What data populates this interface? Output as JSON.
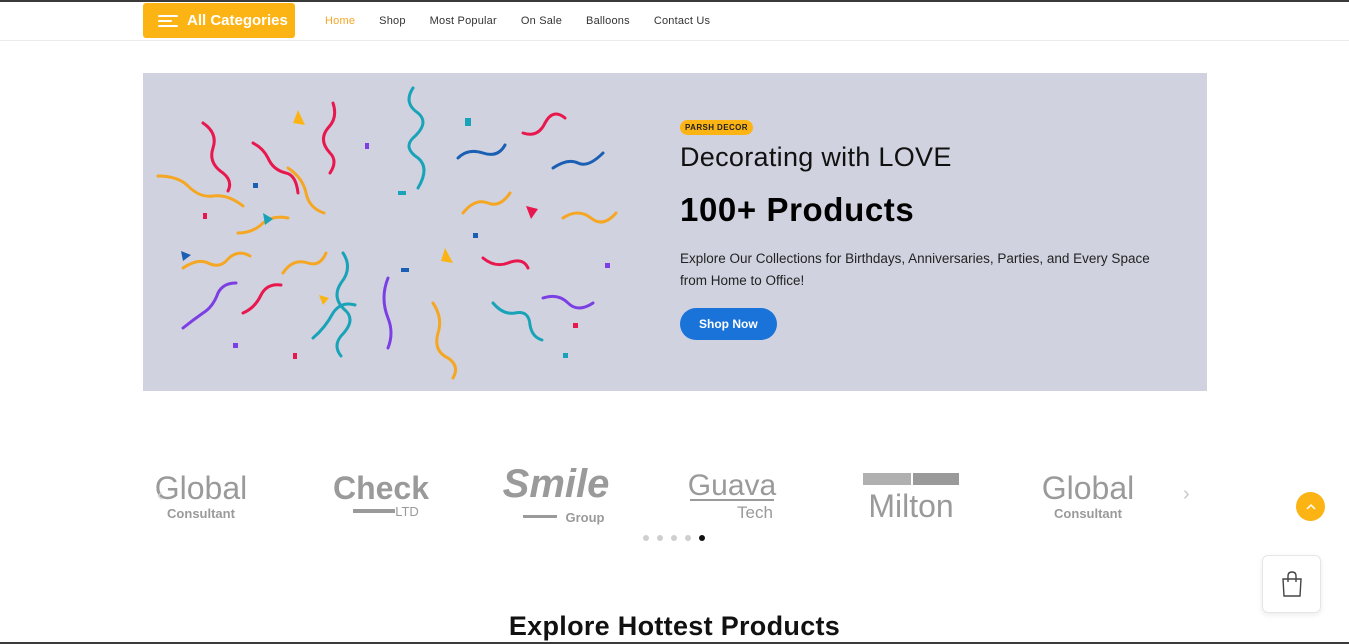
{
  "nav": {
    "categories_label": "All Categories",
    "links": [
      "Home",
      "Shop",
      "Most Popular",
      "On Sale",
      "Balloons",
      "Contact Us"
    ],
    "active": "Home",
    "accent_color": "#fcb415"
  },
  "hero": {
    "badge": "PARSH DECOR",
    "subtitle": "Decorating with LOVE",
    "title": "100+ Products",
    "description": "Explore Our Collections for Birthdays, Anniversaries, Parties, and Every Space from Home to Office!",
    "cta": "Shop Now",
    "background": "#d0d3df",
    "cta_color": "#1a73d9"
  },
  "brands": [
    {
      "name": "Global",
      "tagline": "Consultant"
    },
    {
      "name": "Check",
      "tagline": "LTD"
    },
    {
      "name": "Smile",
      "tagline": "Group"
    },
    {
      "name": "Guava",
      "tagline": "Tech"
    },
    {
      "name": "Milton",
      "tagline": ""
    },
    {
      "name": "Global",
      "tagline": "Consultant"
    }
  ],
  "carousel": {
    "dots": 5,
    "active_dot": 5
  },
  "icons": {
    "menu": "menu-icon",
    "prev": "chevron-left-icon",
    "next": "chevron-right-icon",
    "scroll_top": "chevron-up-icon",
    "cart": "shopping-bag-icon"
  },
  "section": {
    "title": "Explore Hottest Products"
  }
}
